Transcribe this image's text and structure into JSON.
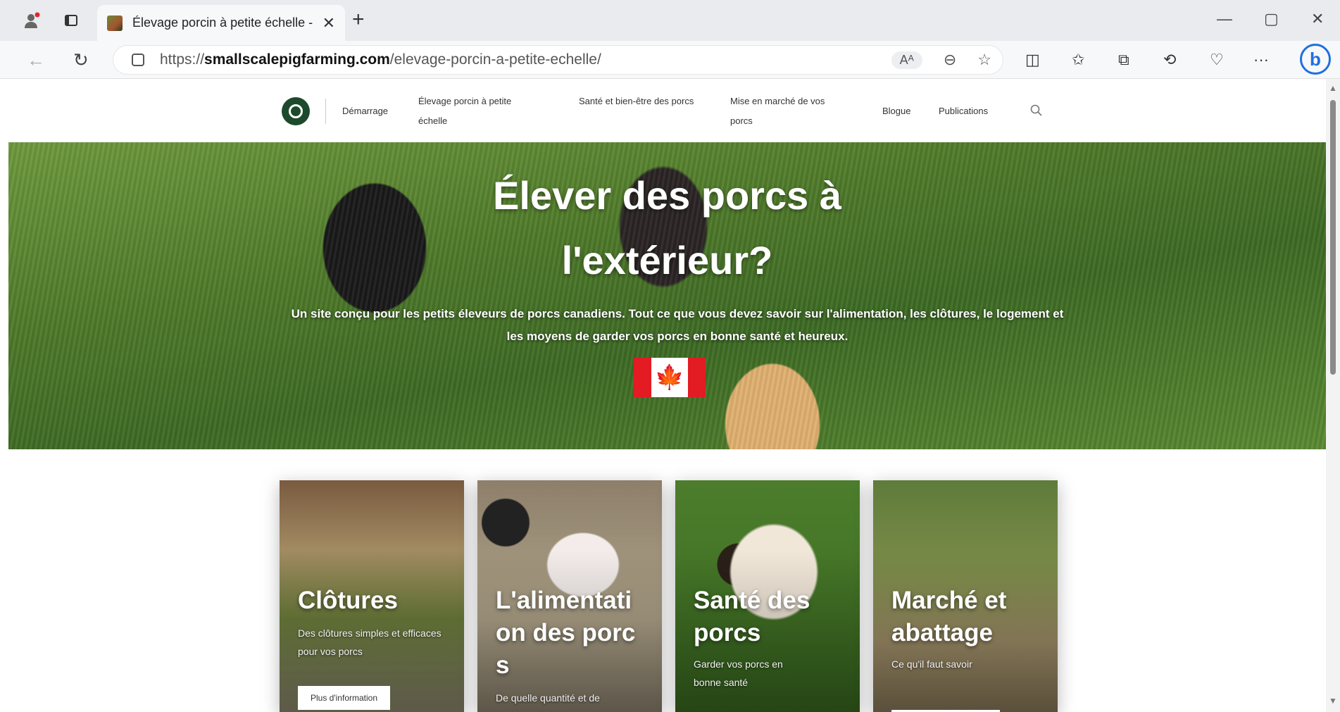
{
  "browser": {
    "tab_title": "Élevage porcin à petite échelle -",
    "url_domain": "smallscalepigfarming.com",
    "url_prefix": "https://",
    "url_path": "/elevage-porcin-a-petite-echelle/",
    "read_aloud_label": "Aᴬ"
  },
  "site_nav": {
    "items": [
      "Démarrage",
      "Élevage porcin à petite échelle",
      "Santé et bien-être des porcs",
      "Mise en marché de vos porcs",
      "Blogue",
      "Publications"
    ]
  },
  "hero": {
    "title": "Élever des porcs à l'extérieur?",
    "subtitle": "Un site conçu pour les petits éleveurs de porcs canadiens. Tout ce que vous devez savoir sur l'alimentation, les clôtures, le logement et les moyens de garder vos porcs en bonne santé et heureux."
  },
  "cards": [
    {
      "title": "Clôtures",
      "desc": "Des clôtures simples et efficaces pour vos porcs",
      "button": "Plus d'information"
    },
    {
      "title": "L'alimentation des porcs",
      "desc": "De quelle quantité et de",
      "button": ""
    },
    {
      "title": "Santé des porcs",
      "desc": "Garder vos porcs en bonne santé",
      "button": ""
    },
    {
      "title": "Marché et abattage",
      "desc": "Ce qu'il faut savoir",
      "button": ""
    }
  ],
  "colors": {
    "flag_red": "#e31b23",
    "logo_green": "#1d4a2c",
    "bing_blue": "#1f6fe0"
  }
}
